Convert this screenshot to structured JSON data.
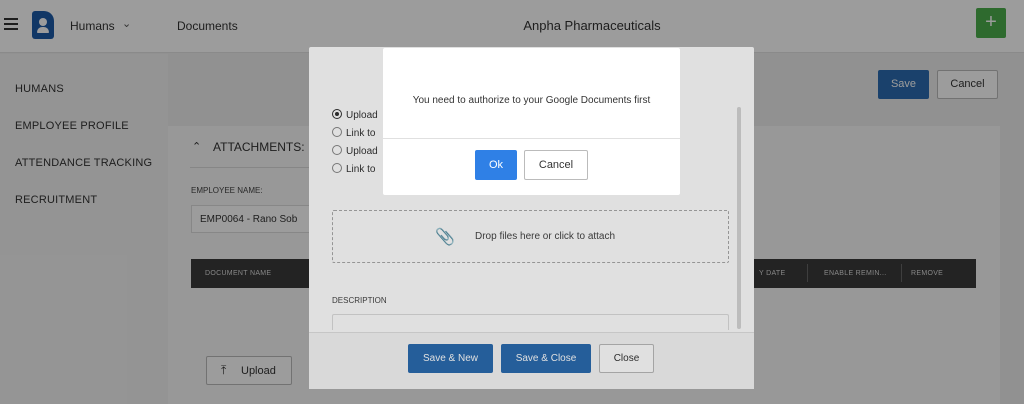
{
  "header": {
    "module": "Humans",
    "breadcrumb": "Documents",
    "company": "Anpha Pharmaceuticals"
  },
  "sidebar": {
    "items": [
      {
        "label": "HUMANS"
      },
      {
        "label": "EMPLOYEE PROFILE"
      },
      {
        "label": "ATTENDANCE TRACKING"
      },
      {
        "label": "RECRUITMENT"
      }
    ]
  },
  "toolbar": {
    "save_label": "Save",
    "cancel_label": "Cancel"
  },
  "attachments": {
    "title": "ATTACHMENTS:",
    "employee_label": "EMPLOYEE NAME:",
    "employee_value": "EMP0064 - Rano Sob",
    "columns": [
      "DOCUMENT NAME",
      "Y DATE",
      "ENABLE REMIN...",
      "REMOVE"
    ],
    "upload_label": "Upload"
  },
  "attach_dialog": {
    "options": [
      {
        "label": "Upload",
        "checked": true
      },
      {
        "label": "Link to",
        "checked": false
      },
      {
        "label": "Upload",
        "checked": false
      },
      {
        "label": "Link to",
        "checked": false
      }
    ],
    "drop_text": "Drop files here or click to attach",
    "description_label": "DESCRIPTION",
    "save_new_label": "Save & New",
    "save_close_label": "Save & Close",
    "close_label": "Close"
  },
  "alert": {
    "message": "You need to authorize to your Google Documents first",
    "ok_label": "Ok",
    "cancel_label": "Cancel"
  },
  "colors": {
    "primary": "#2b6cb0",
    "alert_ok": "#2f80e6",
    "add_button": "#4cae4c"
  }
}
